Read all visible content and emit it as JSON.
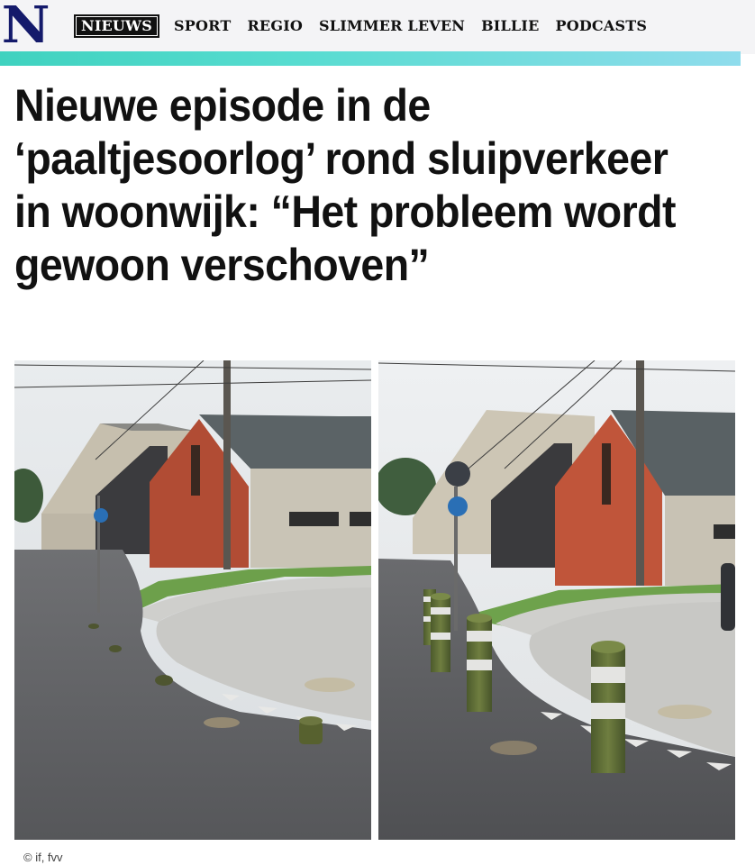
{
  "brand": {
    "logo_letter": "N",
    "color": "#141a6b"
  },
  "nav": {
    "items": [
      {
        "label": "NIEUWS",
        "active": true
      },
      {
        "label": "SPORT"
      },
      {
        "label": "REGIO"
      },
      {
        "label": "SLIMMER LEVEN"
      },
      {
        "label": "BILLIE"
      },
      {
        "label": "PODCASTS"
      }
    ]
  },
  "article": {
    "headline": "Nieuwe episode in de ‘paaltjesoorlog’ rond sluipverkeer in woonwijk: “Het probleem wordt gewoon verschoven”",
    "photo_credit": "© if, fvv"
  },
  "colors": {
    "accent_start": "#3fd2bf",
    "accent_end": "#8fdcec",
    "text": "#111111"
  }
}
